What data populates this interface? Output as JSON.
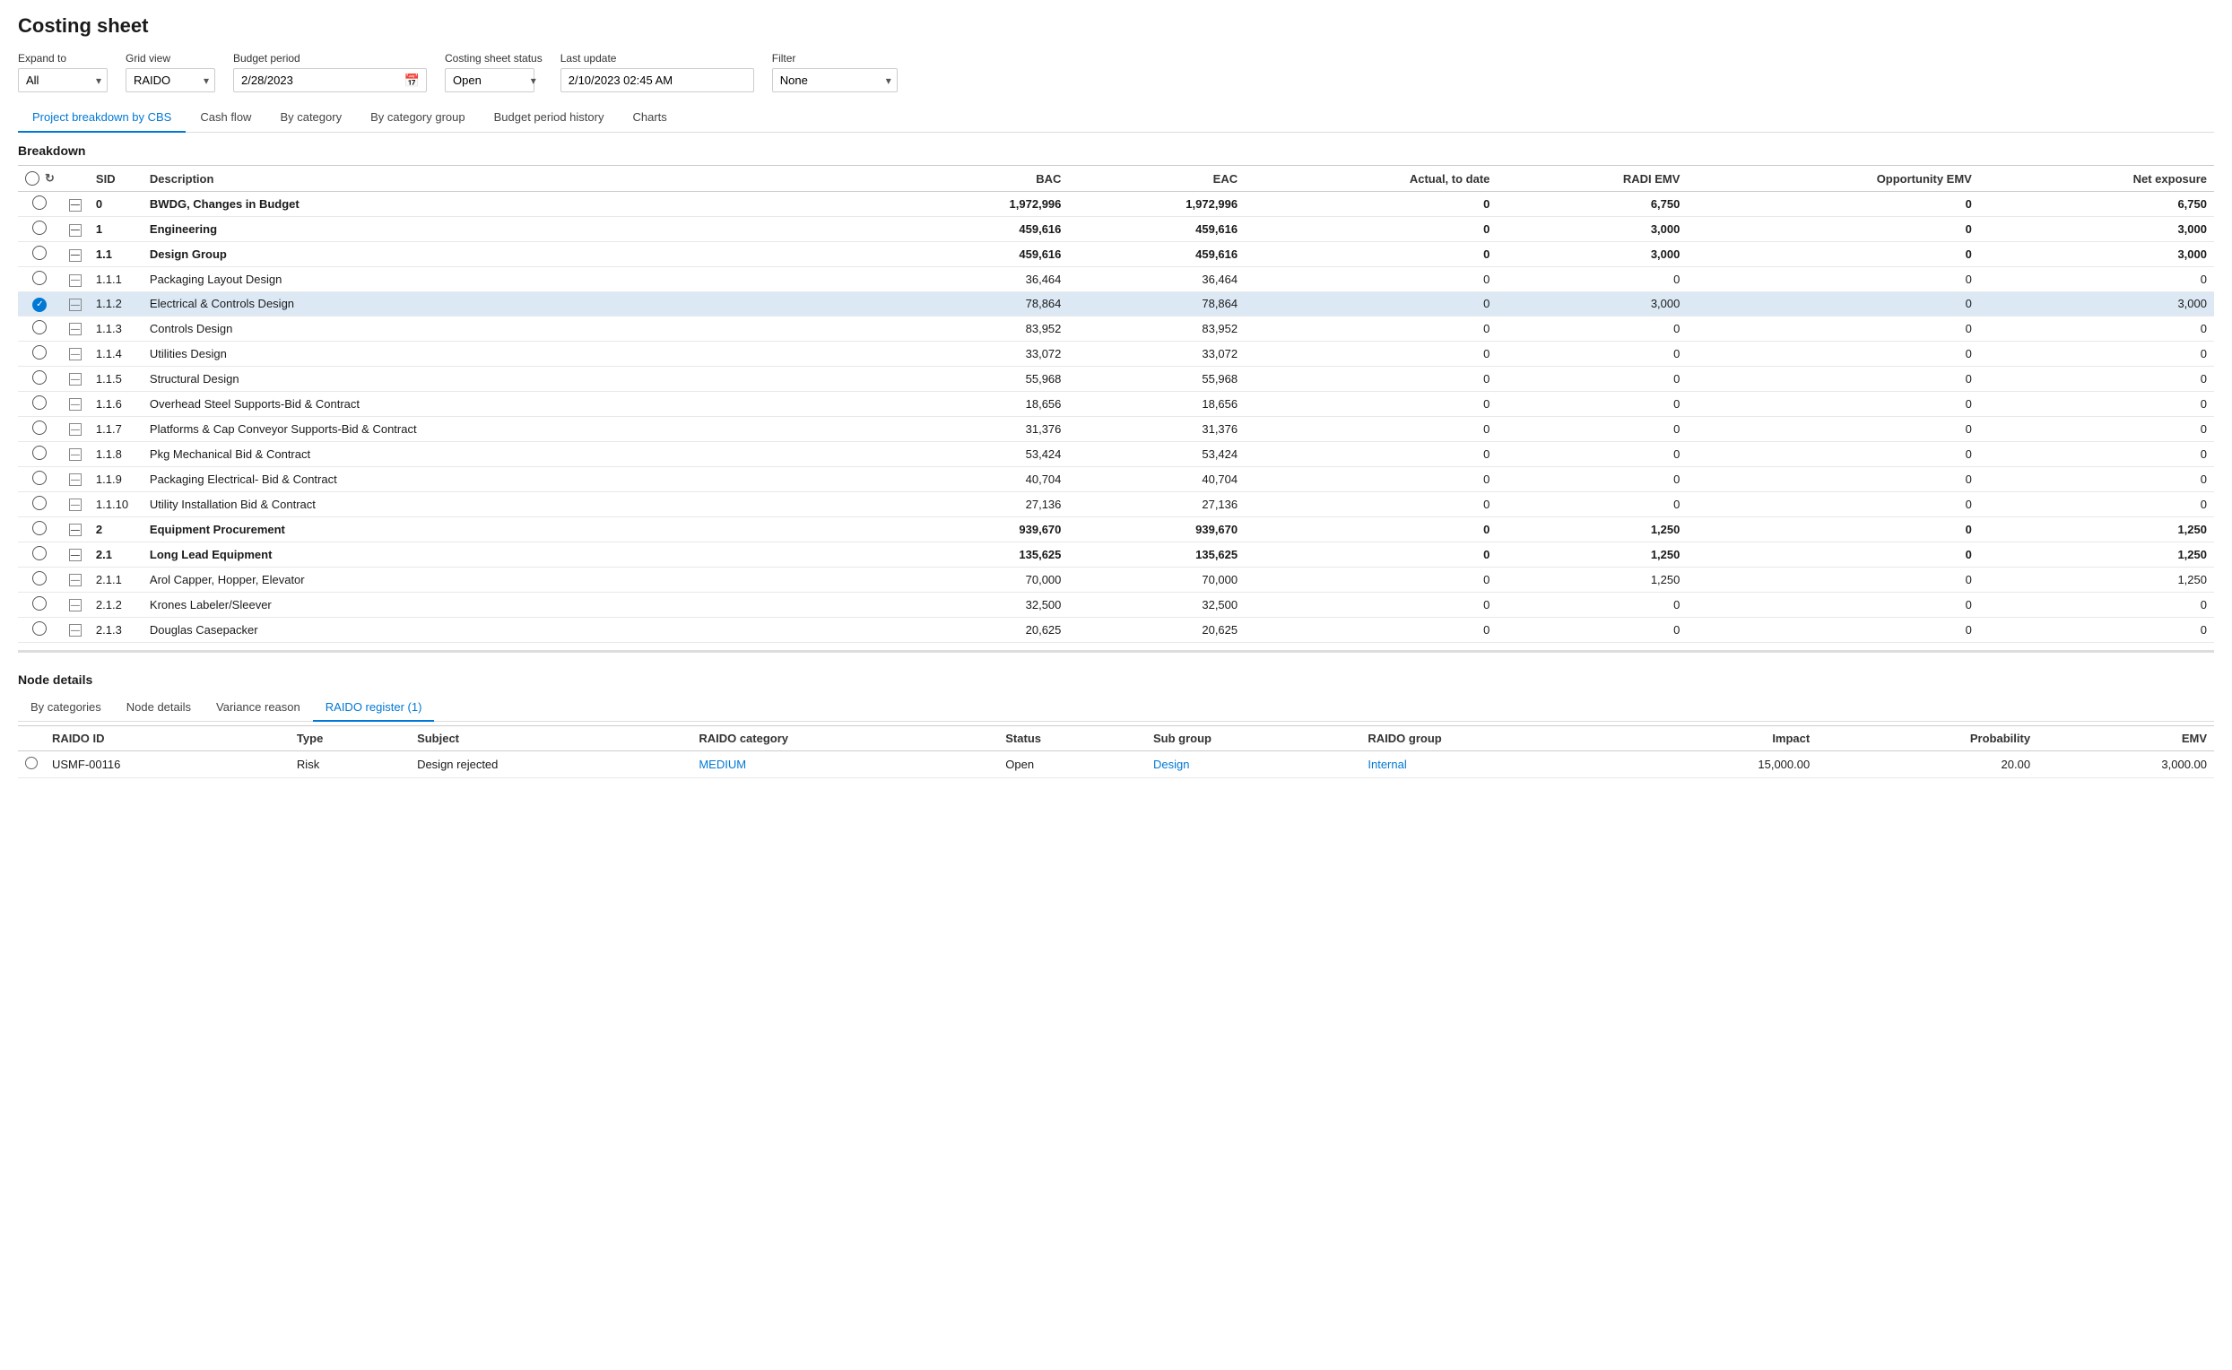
{
  "pageTitle": "Costing sheet",
  "controls": {
    "expandTo": {
      "label": "Expand to",
      "value": "All"
    },
    "gridView": {
      "label": "Grid view",
      "value": "RAIDO"
    },
    "budgetPeriod": {
      "label": "Budget period",
      "value": "2/28/2023"
    },
    "costingSheetStatus": {
      "label": "Costing sheet status",
      "value": "Open"
    },
    "lastUpdate": {
      "label": "Last update",
      "value": "2/10/2023 02:45 AM"
    },
    "filter": {
      "label": "Filter",
      "value": "None"
    }
  },
  "tabs": [
    {
      "id": "cbs",
      "label": "Project breakdown by CBS",
      "active": true
    },
    {
      "id": "cashflow",
      "label": "Cash flow",
      "active": false
    },
    {
      "id": "category",
      "label": "By category",
      "active": false
    },
    {
      "id": "categorygroup",
      "label": "By category group",
      "active": false
    },
    {
      "id": "budgetperiod",
      "label": "Budget period history",
      "active": false
    },
    {
      "id": "charts",
      "label": "Charts",
      "active": false
    }
  ],
  "breakdown": {
    "title": "Breakdown",
    "columns": [
      {
        "key": "bac",
        "label": "BAC"
      },
      {
        "key": "eac",
        "label": "EAC"
      },
      {
        "key": "actual",
        "label": "Actual, to date"
      },
      {
        "key": "radiemv",
        "label": "RADI EMV"
      },
      {
        "key": "opportunityemv",
        "label": "Opportunity EMV"
      },
      {
        "key": "netexposure",
        "label": "Net exposure"
      }
    ],
    "rows": [
      {
        "sid": "0",
        "description": "BWDG, Changes in Budget",
        "bac": "1,972,996",
        "eac": "1,972,996",
        "actual": "0",
        "radiemv": "6,750",
        "opportunityemv": "0",
        "netexposure": "6,750",
        "bold": true,
        "selected": false,
        "checked": false
      },
      {
        "sid": "1",
        "description": "Engineering",
        "bac": "459,616",
        "eac": "459,616",
        "actual": "0",
        "radiemv": "3,000",
        "opportunityemv": "0",
        "netexposure": "3,000",
        "bold": true,
        "selected": false,
        "checked": false
      },
      {
        "sid": "1.1",
        "description": "Design Group",
        "bac": "459,616",
        "eac": "459,616",
        "actual": "0",
        "radiemv": "3,000",
        "opportunityemv": "0",
        "netexposure": "3,000",
        "bold": true,
        "selected": false,
        "checked": false
      },
      {
        "sid": "1.1.1",
        "description": "Packaging Layout Design",
        "bac": "36,464",
        "eac": "36,464",
        "actual": "0",
        "radiemv": "0",
        "opportunityemv": "0",
        "netexposure": "0",
        "bold": false,
        "selected": false,
        "checked": false
      },
      {
        "sid": "1.1.2",
        "description": "Electrical & Controls Design",
        "bac": "78,864",
        "eac": "78,864",
        "actual": "0",
        "radiemv": "3,000",
        "opportunityemv": "0",
        "netexposure": "3,000",
        "bold": false,
        "selected": true,
        "checked": true
      },
      {
        "sid": "1.1.3",
        "description": "Controls Design",
        "bac": "83,952",
        "eac": "83,952",
        "actual": "0",
        "radiemv": "0",
        "opportunityemv": "0",
        "netexposure": "0",
        "bold": false,
        "selected": false,
        "checked": false
      },
      {
        "sid": "1.1.4",
        "description": "Utilities Design",
        "bac": "33,072",
        "eac": "33,072",
        "actual": "0",
        "radiemv": "0",
        "opportunityemv": "0",
        "netexposure": "0",
        "bold": false,
        "selected": false,
        "checked": false
      },
      {
        "sid": "1.1.5",
        "description": "Structural Design",
        "bac": "55,968",
        "eac": "55,968",
        "actual": "0",
        "radiemv": "0",
        "opportunityemv": "0",
        "netexposure": "0",
        "bold": false,
        "selected": false,
        "checked": false
      },
      {
        "sid": "1.1.6",
        "description": "Overhead Steel Supports-Bid & Contract",
        "bac": "18,656",
        "eac": "18,656",
        "actual": "0",
        "radiemv": "0",
        "opportunityemv": "0",
        "netexposure": "0",
        "bold": false,
        "selected": false,
        "checked": false
      },
      {
        "sid": "1.1.7",
        "description": "Platforms & Cap Conveyor Supports-Bid & Contract",
        "bac": "31,376",
        "eac": "31,376",
        "actual": "0",
        "radiemv": "0",
        "opportunityemv": "0",
        "netexposure": "0",
        "bold": false,
        "selected": false,
        "checked": false
      },
      {
        "sid": "1.1.8",
        "description": "Pkg Mechanical Bid & Contract",
        "bac": "53,424",
        "eac": "53,424",
        "actual": "0",
        "radiemv": "0",
        "opportunityemv": "0",
        "netexposure": "0",
        "bold": false,
        "selected": false,
        "checked": false
      },
      {
        "sid": "1.1.9",
        "description": "Packaging Electrical- Bid & Contract",
        "bac": "40,704",
        "eac": "40,704",
        "actual": "0",
        "radiemv": "0",
        "opportunityemv": "0",
        "netexposure": "0",
        "bold": false,
        "selected": false,
        "checked": false
      },
      {
        "sid": "1.1.10",
        "description": "Utility Installation Bid & Contract",
        "bac": "27,136",
        "eac": "27,136",
        "actual": "0",
        "radiemv": "0",
        "opportunityemv": "0",
        "netexposure": "0",
        "bold": false,
        "selected": false,
        "checked": false
      },
      {
        "sid": "2",
        "description": "Equipment Procurement",
        "bac": "939,670",
        "eac": "939,670",
        "actual": "0",
        "radiemv": "1,250",
        "opportunityemv": "0",
        "netexposure": "1,250",
        "bold": true,
        "selected": false,
        "checked": false
      },
      {
        "sid": "2.1",
        "description": "Long Lead Equipment",
        "bac": "135,625",
        "eac": "135,625",
        "actual": "0",
        "radiemv": "1,250",
        "opportunityemv": "0",
        "netexposure": "1,250",
        "bold": true,
        "selected": false,
        "checked": false
      },
      {
        "sid": "2.1.1",
        "description": "Arol Capper, Hopper, Elevator",
        "bac": "70,000",
        "eac": "70,000",
        "actual": "0",
        "radiemv": "1,250",
        "opportunityemv": "0",
        "netexposure": "1,250",
        "bold": false,
        "selected": false,
        "checked": false
      },
      {
        "sid": "2.1.2",
        "description": "Krones Labeler/Sleever",
        "bac": "32,500",
        "eac": "32,500",
        "actual": "0",
        "radiemv": "0",
        "opportunityemv": "0",
        "netexposure": "0",
        "bold": false,
        "selected": false,
        "checked": false
      },
      {
        "sid": "2.1.3",
        "description": "Douglas Casepacker",
        "bac": "20,625",
        "eac": "20,625",
        "actual": "0",
        "radiemv": "0",
        "opportunityemv": "0",
        "netexposure": "0",
        "bold": false,
        "selected": false,
        "checked": false
      }
    ]
  },
  "nodeDetails": {
    "title": "Node details",
    "tabs": [
      {
        "id": "bycategories",
        "label": "By categories",
        "active": false
      },
      {
        "id": "nodedetails",
        "label": "Node details",
        "active": false
      },
      {
        "id": "variancereason",
        "label": "Variance reason",
        "active": false
      },
      {
        "id": "raidoregister",
        "label": "RAIDO register (1)",
        "active": true
      }
    ],
    "columns": [
      {
        "key": "raidoid",
        "label": "RAIDO ID"
      },
      {
        "key": "type",
        "label": "Type"
      },
      {
        "key": "subject",
        "label": "Subject"
      },
      {
        "key": "raidocategory",
        "label": "RAIDO category"
      },
      {
        "key": "status",
        "label": "Status"
      },
      {
        "key": "subgroup",
        "label": "Sub group"
      },
      {
        "key": "raidogroup",
        "label": "RAIDO group"
      },
      {
        "key": "impact",
        "label": "Impact"
      },
      {
        "key": "probability",
        "label": "Probability"
      },
      {
        "key": "emv",
        "label": "EMV"
      }
    ],
    "rows": [
      {
        "raidoid": "USMF-00116",
        "type": "Risk",
        "subject": "Design rejected",
        "raidocategory": "MEDIUM",
        "status": "Open",
        "subgroup": "Design",
        "raidogroup": "Internal",
        "impact": "15,000.00",
        "probability": "20.00",
        "emv": "3,000.00"
      }
    ]
  }
}
